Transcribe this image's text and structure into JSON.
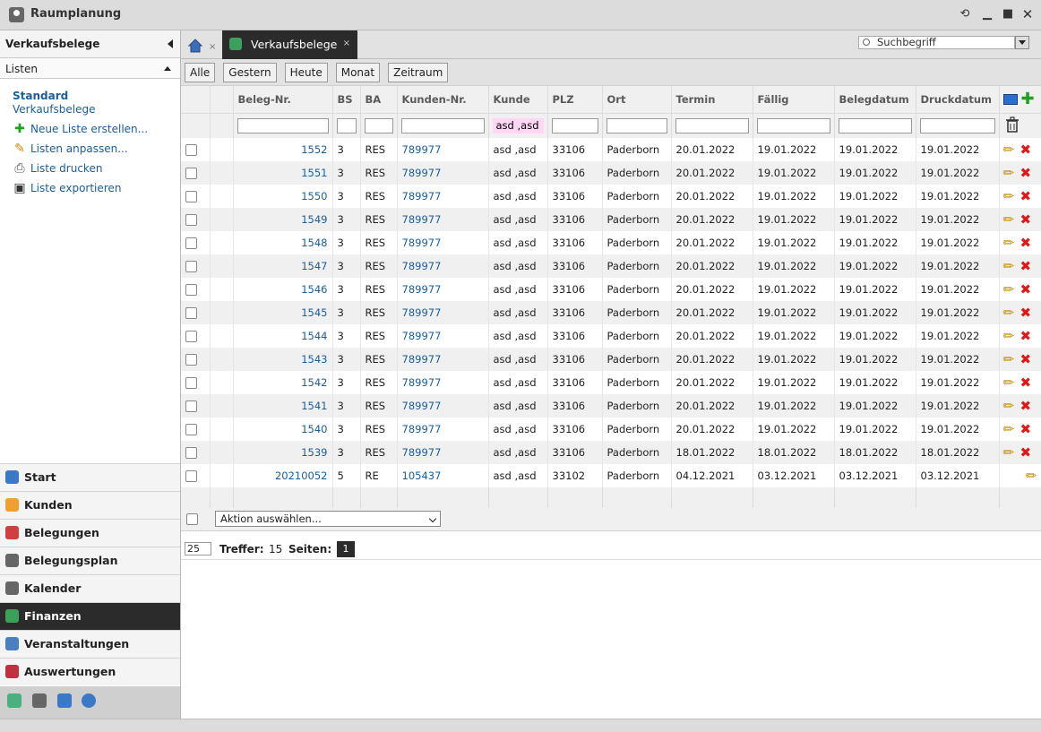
{
  "app": {
    "title": "Raumplanung"
  },
  "sidebar": {
    "header": "Verkaufsbelege",
    "lists_label": "Listen",
    "standard": "Standard",
    "standard_sub": "Verkaufsbelege",
    "links": [
      {
        "label": "Neue Liste erstellen...",
        "icon": "plus-icon"
      },
      {
        "label": "Listen anpassen...",
        "icon": "edit-list-icon"
      },
      {
        "label": "Liste drucken",
        "icon": "print-icon"
      },
      {
        "label": "Liste exportieren",
        "icon": "save-icon"
      }
    ],
    "nav": [
      {
        "label": "Start",
        "color": "#3a78c8"
      },
      {
        "label": "Kunden",
        "color": "#f0a030"
      },
      {
        "label": "Belegungen",
        "color": "#d04040"
      },
      {
        "label": "Belegungsplan",
        "color": "#666666"
      },
      {
        "label": "Kalender",
        "color": "#666666"
      },
      {
        "label": "Finanzen",
        "color": "#3aa05a"
      },
      {
        "label": "Veranstaltungen",
        "color": "#4a80c0"
      },
      {
        "label": "Auswertungen",
        "color": "#c03040"
      }
    ],
    "active_nav": "Finanzen"
  },
  "tabs": {
    "active": "Verkaufsbelege",
    "close": "×",
    "home_close": "×"
  },
  "search": {
    "placeholder": "Suchbegriff"
  },
  "filters": [
    "Alle",
    "Gestern",
    "Heute",
    "Monat",
    "Zeitraum"
  ],
  "table": {
    "columns": [
      "",
      "",
      "Beleg-Nr.",
      "BS",
      "BA",
      "Kunden-Nr.",
      "Kunde",
      "PLZ",
      "Ort",
      "Termin",
      "Fällig",
      "Belegdatum",
      "Druckdatum",
      ""
    ],
    "kunde_filter": "asd ,asd",
    "rows": [
      {
        "nr": "1552",
        "bs": "3",
        "ba": "RES",
        "kdnr": "789977",
        "kunde": "asd ,asd",
        "plz": "33106",
        "ort": "Paderborn",
        "termin": "20.01.2022",
        "faellig": "19.01.2022",
        "beleg": "19.01.2022",
        "druck": "19.01.2022",
        "del": true
      },
      {
        "nr": "1551",
        "bs": "3",
        "ba": "RES",
        "kdnr": "789977",
        "kunde": "asd ,asd",
        "plz": "33106",
        "ort": "Paderborn",
        "termin": "20.01.2022",
        "faellig": "19.01.2022",
        "beleg": "19.01.2022",
        "druck": "19.01.2022",
        "del": true
      },
      {
        "nr": "1550",
        "bs": "3",
        "ba": "RES",
        "kdnr": "789977",
        "kunde": "asd ,asd",
        "plz": "33106",
        "ort": "Paderborn",
        "termin": "20.01.2022",
        "faellig": "19.01.2022",
        "beleg": "19.01.2022",
        "druck": "19.01.2022",
        "del": true
      },
      {
        "nr": "1549",
        "bs": "3",
        "ba": "RES",
        "kdnr": "789977",
        "kunde": "asd ,asd",
        "plz": "33106",
        "ort": "Paderborn",
        "termin": "20.01.2022",
        "faellig": "19.01.2022",
        "beleg": "19.01.2022",
        "druck": "19.01.2022",
        "del": true
      },
      {
        "nr": "1548",
        "bs": "3",
        "ba": "RES",
        "kdnr": "789977",
        "kunde": "asd ,asd",
        "plz": "33106",
        "ort": "Paderborn",
        "termin": "20.01.2022",
        "faellig": "19.01.2022",
        "beleg": "19.01.2022",
        "druck": "19.01.2022",
        "del": true
      },
      {
        "nr": "1547",
        "bs": "3",
        "ba": "RES",
        "kdnr": "789977",
        "kunde": "asd ,asd",
        "plz": "33106",
        "ort": "Paderborn",
        "termin": "20.01.2022",
        "faellig": "19.01.2022",
        "beleg": "19.01.2022",
        "druck": "19.01.2022",
        "del": true
      },
      {
        "nr": "1546",
        "bs": "3",
        "ba": "RES",
        "kdnr": "789977",
        "kunde": "asd ,asd",
        "plz": "33106",
        "ort": "Paderborn",
        "termin": "20.01.2022",
        "faellig": "19.01.2022",
        "beleg": "19.01.2022",
        "druck": "19.01.2022",
        "del": true
      },
      {
        "nr": "1545",
        "bs": "3",
        "ba": "RES",
        "kdnr": "789977",
        "kunde": "asd ,asd",
        "plz": "33106",
        "ort": "Paderborn",
        "termin": "20.01.2022",
        "faellig": "19.01.2022",
        "beleg": "19.01.2022",
        "druck": "19.01.2022",
        "del": true
      },
      {
        "nr": "1544",
        "bs": "3",
        "ba": "RES",
        "kdnr": "789977",
        "kunde": "asd ,asd",
        "plz": "33106",
        "ort": "Paderborn",
        "termin": "20.01.2022",
        "faellig": "19.01.2022",
        "beleg": "19.01.2022",
        "druck": "19.01.2022",
        "del": true
      },
      {
        "nr": "1543",
        "bs": "3",
        "ba": "RES",
        "kdnr": "789977",
        "kunde": "asd ,asd",
        "plz": "33106",
        "ort": "Paderborn",
        "termin": "20.01.2022",
        "faellig": "19.01.2022",
        "beleg": "19.01.2022",
        "druck": "19.01.2022",
        "del": true
      },
      {
        "nr": "1542",
        "bs": "3",
        "ba": "RES",
        "kdnr": "789977",
        "kunde": "asd ,asd",
        "plz": "33106",
        "ort": "Paderborn",
        "termin": "20.01.2022",
        "faellig": "19.01.2022",
        "beleg": "19.01.2022",
        "druck": "19.01.2022",
        "del": true
      },
      {
        "nr": "1541",
        "bs": "3",
        "ba": "RES",
        "kdnr": "789977",
        "kunde": "asd ,asd",
        "plz": "33106",
        "ort": "Paderborn",
        "termin": "20.01.2022",
        "faellig": "19.01.2022",
        "beleg": "19.01.2022",
        "druck": "19.01.2022",
        "del": true
      },
      {
        "nr": "1540",
        "bs": "3",
        "ba": "RES",
        "kdnr": "789977",
        "kunde": "asd ,asd",
        "plz": "33106",
        "ort": "Paderborn",
        "termin": "20.01.2022",
        "faellig": "19.01.2022",
        "beleg": "19.01.2022",
        "druck": "19.01.2022",
        "del": true
      },
      {
        "nr": "1539",
        "bs": "3",
        "ba": "RES",
        "kdnr": "789977",
        "kunde": "asd ,asd",
        "plz": "33106",
        "ort": "Paderborn",
        "termin": "18.01.2022",
        "faellig": "18.01.2022",
        "beleg": "18.01.2022",
        "druck": "18.01.2022",
        "del": true
      },
      {
        "nr": "20210052",
        "bs": "5",
        "ba": "RE",
        "kdnr": "105437",
        "kunde": "asd ,asd",
        "plz": "33102",
        "ort": "Paderborn",
        "termin": "04.12.2021",
        "faellig": "03.12.2021",
        "beleg": "03.12.2021",
        "druck": "03.12.2021",
        "del": false
      }
    ]
  },
  "action": {
    "placeholder": "Aktion auswählen..."
  },
  "pager": {
    "per_page": "25",
    "hits_label": "Treffer:",
    "hits": "15",
    "pages_label": "Seiten:",
    "page": "1"
  }
}
